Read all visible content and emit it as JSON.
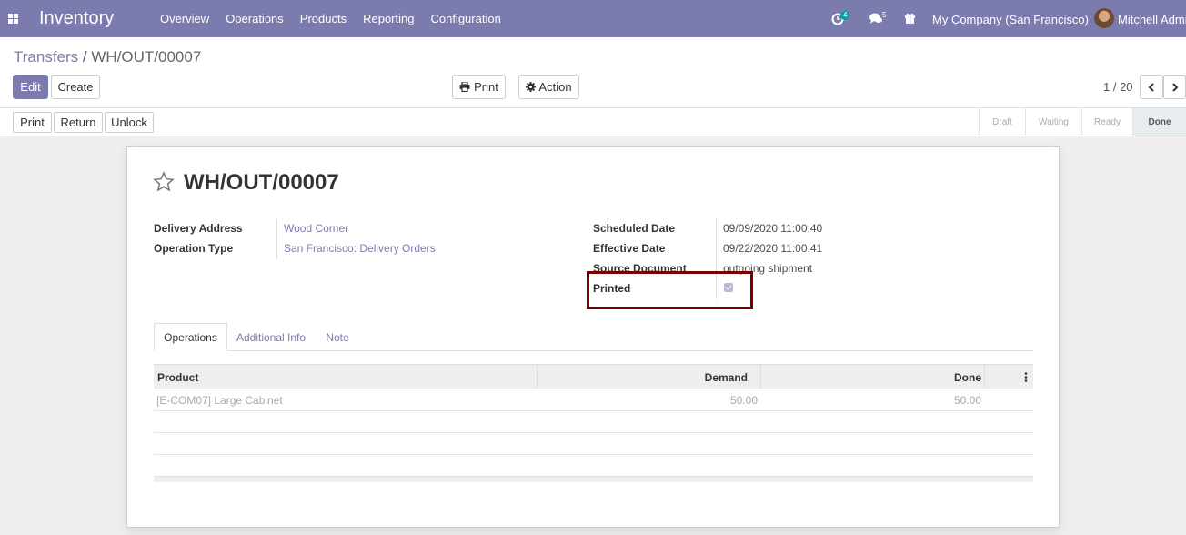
{
  "navbar": {
    "app_name": "Inventory",
    "menu": [
      "Overview",
      "Operations",
      "Products",
      "Reporting",
      "Configuration"
    ],
    "activity_count": "4",
    "messages_count": "5",
    "company": "My Company (San Francisco)",
    "user": "Mitchell Admin"
  },
  "breadcrumb": {
    "parent": "Transfers",
    "separator": "/",
    "current": "WH/OUT/00007"
  },
  "control_panel": {
    "edit": "Edit",
    "create": "Create",
    "print": "Print",
    "action": "Action",
    "pager": "1 / 20"
  },
  "statusbar": {
    "buttons": [
      "Print",
      "Return",
      "Unlock"
    ],
    "stages": [
      "Draft",
      "Waiting",
      "Ready",
      "Done"
    ],
    "active_stage": "Done"
  },
  "form": {
    "title": "WH/OUT/00007",
    "fields_left": [
      {
        "label": "Delivery Address",
        "value": "Wood Corner"
      },
      {
        "label": "Operation Type",
        "value": "San Francisco: Delivery Orders"
      }
    ],
    "fields_right": [
      {
        "label": "Scheduled Date",
        "value": "09/09/2020 11:00:40"
      },
      {
        "label": "Effective Date",
        "value": "09/22/2020 11:00:41"
      },
      {
        "label": "Source Document",
        "value": "outgoing shipment"
      },
      {
        "label": "Printed",
        "value": ""
      }
    ],
    "printed_checked": true
  },
  "tabs": [
    "Operations",
    "Additional Info",
    "Note"
  ],
  "table": {
    "columns": [
      "Product",
      "Demand",
      "Done"
    ],
    "rows": [
      {
        "product": "[E-COM07] Large Cabinet",
        "demand": "50.00",
        "done": "50.00"
      }
    ]
  },
  "colors": {
    "brand": "#7c7bad",
    "highlight_border": "#7a0000"
  }
}
